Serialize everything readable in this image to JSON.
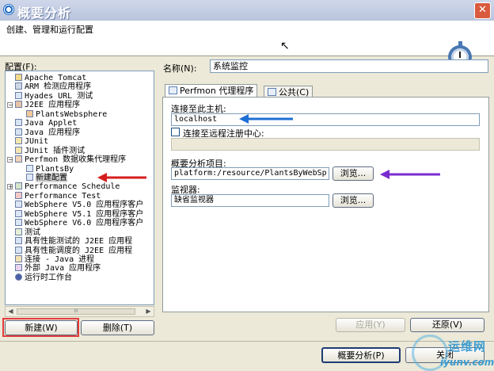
{
  "window": {
    "title": "概要分析"
  },
  "banner": {
    "text": "创建、管理和运行配置"
  },
  "config": {
    "label": "配置(F):",
    "tree": [
      {
        "label": "Apache Tomcat"
      },
      {
        "label": "ARM 检测应用程序"
      },
      {
        "label": "Hyades URL 测试"
      },
      {
        "label": "J2EE 应用程序",
        "expander": "−"
      },
      {
        "label": "PlantsWebsphere"
      },
      {
        "label": "Java Applet"
      },
      {
        "label": "Java 应用程序"
      },
      {
        "label": "JUnit"
      },
      {
        "label": "JUnit 插件测试"
      },
      {
        "label": "Perfmon 数据收集代理程序",
        "expander": "−"
      },
      {
        "label": "PlantsBy"
      },
      {
        "label": "新建配置"
      },
      {
        "label": "Performance Schedule",
        "expander": "+"
      },
      {
        "label": "Performance Test"
      },
      {
        "label": "WebSphere V5.0 应用程序客户"
      },
      {
        "label": "WebSphere V5.1 应用程序客户"
      },
      {
        "label": "WebSphere V6.0 应用程序客户"
      },
      {
        "label": "测试"
      },
      {
        "label": "具有性能测试的 J2EE 应用程"
      },
      {
        "label": "具有性能调度的 J2EE 应用程"
      },
      {
        "label": "连接 - Java 进程"
      },
      {
        "label": "外部 Java 应用程序"
      },
      {
        "label": "运行时工作台"
      }
    ],
    "new_button": "新建(W)",
    "delete_button": "删除(T)",
    "scroll_thumb_grip": "III"
  },
  "name": {
    "label": "名称(N):",
    "value": "系统监控"
  },
  "tabs": [
    {
      "label": "Perfmon 代理程序"
    },
    {
      "label": "公共(C)"
    }
  ],
  "perfmon": {
    "connect_label": "连接至此主机:",
    "host_value": "localhost",
    "remote_checkbox_label": "连接至远程注册中心:",
    "remote_value": "",
    "project_label": "概要分析项目:",
    "project_value": "platform:/resource/PlantsByWebSp",
    "browse1": "浏览...",
    "monitor_label": "监视器:",
    "monitor_value": "缺省监视器",
    "browse2": "浏览..."
  },
  "actions": {
    "apply": "应用(Y)",
    "revert": "还原(V)",
    "profile": "概要分析(P)",
    "close": "关闭"
  },
  "watermark": {
    "line1": "运维网",
    "line2": "iyunv.com"
  },
  "colors": {
    "blue_arrow": "#1e6fd6",
    "red_arrow": "#d61e1e",
    "purple_arrow": "#7a2bd0",
    "highlight_box": "#e23b3b"
  }
}
